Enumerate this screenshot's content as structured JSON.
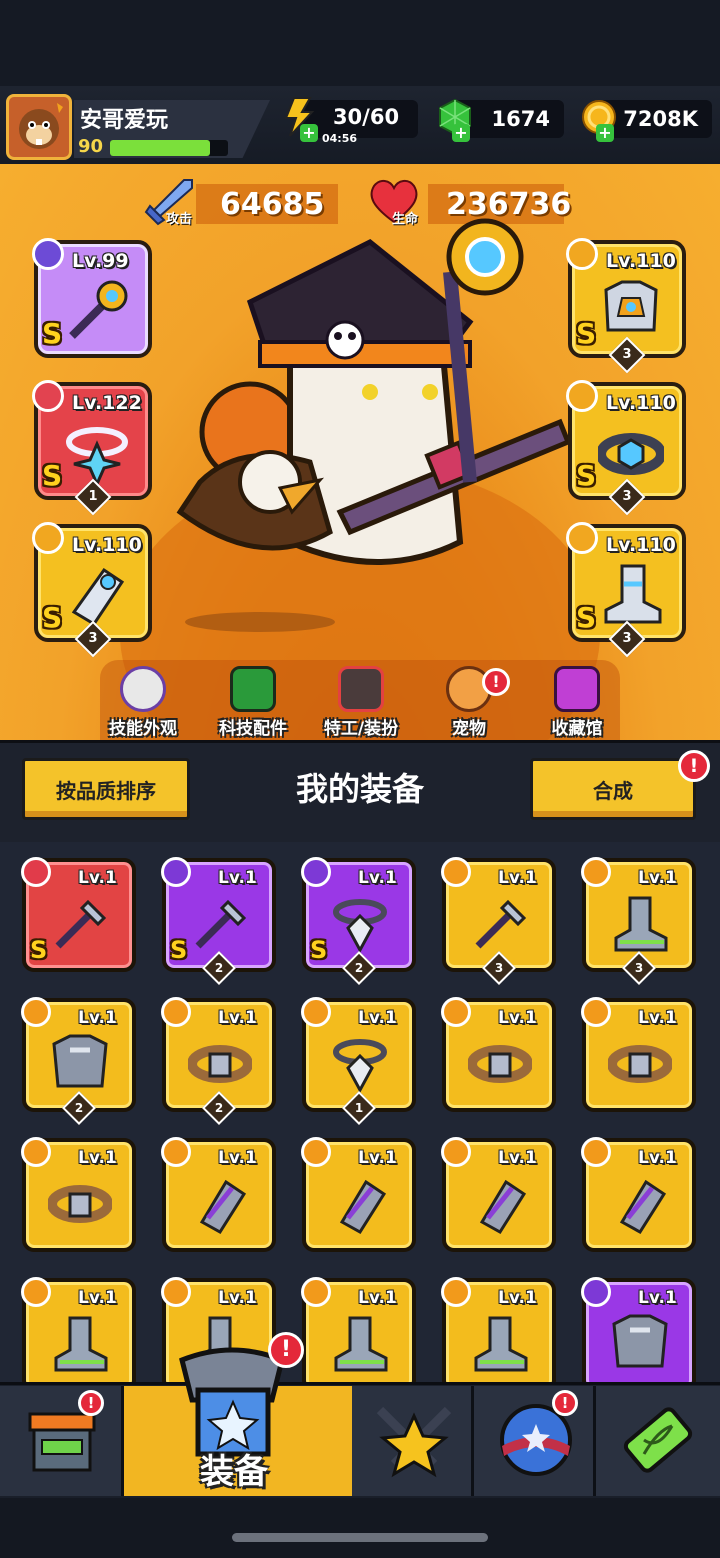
{
  "player": {
    "name": "安哥爱玩",
    "level": "90",
    "xp_progress": 0.85
  },
  "resources": {
    "energy": "30/60",
    "energy_timer": "04:56",
    "gems": "1674",
    "coins": "7208K"
  },
  "stats": {
    "attack_value": "64685",
    "attack_label": "攻击",
    "hp_value": "236736",
    "hp_label": "生命"
  },
  "equipped": {
    "weapon": {
      "level": "Lv.99",
      "rarity": "S"
    },
    "necklace": {
      "level": "Lv.122",
      "rarity": "S",
      "stars": "1"
    },
    "gloves": {
      "level": "Lv.110",
      "rarity": "S",
      "stars": "3"
    },
    "armor": {
      "level": "Lv.110",
      "rarity": "S",
      "stars": "3"
    },
    "belt": {
      "level": "Lv.110",
      "rarity": "S",
      "stars": "3"
    },
    "boots": {
      "level": "Lv.110",
      "rarity": "S",
      "stars": "3"
    }
  },
  "categories": [
    {
      "label": "技能外观"
    },
    {
      "label": "科技配件"
    },
    {
      "label": "特工/装扮"
    },
    {
      "label": "宠物",
      "badge": "!"
    },
    {
      "label": "收藏馆"
    }
  ],
  "toolbar": {
    "sort_label": "按品质排序",
    "title": "我的装备",
    "merge_label": "合成",
    "merge_badge": "!"
  },
  "inventory": [
    {
      "level": "Lv.1",
      "tier": "red",
      "type": "weapon",
      "rarity": "S",
      "stars": ""
    },
    {
      "level": "Lv.1",
      "tier": "purple",
      "type": "weapon",
      "rarity": "S",
      "stars": "2"
    },
    {
      "level": "Lv.1",
      "tier": "purple",
      "type": "necklace",
      "rarity": "S",
      "stars": "2"
    },
    {
      "level": "Lv.1",
      "tier": "gold",
      "type": "weapon",
      "rarity": "",
      "stars": "3"
    },
    {
      "level": "Lv.1",
      "tier": "gold",
      "type": "boots",
      "rarity": "",
      "stars": "3"
    },
    {
      "level": "Lv.1",
      "tier": "gold",
      "type": "armor",
      "rarity": "",
      "stars": "2"
    },
    {
      "level": "Lv.1",
      "tier": "gold",
      "type": "belt",
      "rarity": "",
      "stars": "2"
    },
    {
      "level": "Lv.1",
      "tier": "gold",
      "type": "necklace",
      "rarity": "",
      "stars": "1"
    },
    {
      "level": "Lv.1",
      "tier": "gold",
      "type": "belt",
      "rarity": "",
      "stars": ""
    },
    {
      "level": "Lv.1",
      "tier": "gold",
      "type": "belt",
      "rarity": "",
      "stars": ""
    },
    {
      "level": "Lv.1",
      "tier": "gold",
      "type": "belt",
      "rarity": "",
      "stars": ""
    },
    {
      "level": "Lv.1",
      "tier": "gold",
      "type": "gloves",
      "rarity": "",
      "stars": ""
    },
    {
      "level": "Lv.1",
      "tier": "gold",
      "type": "gloves",
      "rarity": "",
      "stars": ""
    },
    {
      "level": "Lv.1",
      "tier": "gold",
      "type": "gloves",
      "rarity": "",
      "stars": ""
    },
    {
      "level": "Lv.1",
      "tier": "gold",
      "type": "gloves",
      "rarity": "",
      "stars": ""
    },
    {
      "level": "Lv.1",
      "tier": "gold",
      "type": "boots",
      "rarity": "",
      "stars": ""
    },
    {
      "level": "Lv.1",
      "tier": "gold",
      "type": "boots",
      "rarity": "",
      "stars": ""
    },
    {
      "level": "Lv.1",
      "tier": "gold",
      "type": "boots",
      "rarity": "",
      "stars": ""
    },
    {
      "level": "Lv.1",
      "tier": "gold",
      "type": "boots",
      "rarity": "",
      "stars": ""
    },
    {
      "level": "Lv.1",
      "tier": "purple",
      "type": "armor",
      "rarity": "",
      "stars": ""
    }
  ],
  "nav": {
    "shop_badge": "!",
    "equipment_label": "装备",
    "equipment_badge": "!",
    "stars_badge": "!"
  },
  "colors": {
    "accent": "#f4c32a",
    "badge": "#e4283a",
    "tier_red": "#e24444",
    "tier_purple": "#9a38e6",
    "tier_gold": "#f3bc1d"
  }
}
